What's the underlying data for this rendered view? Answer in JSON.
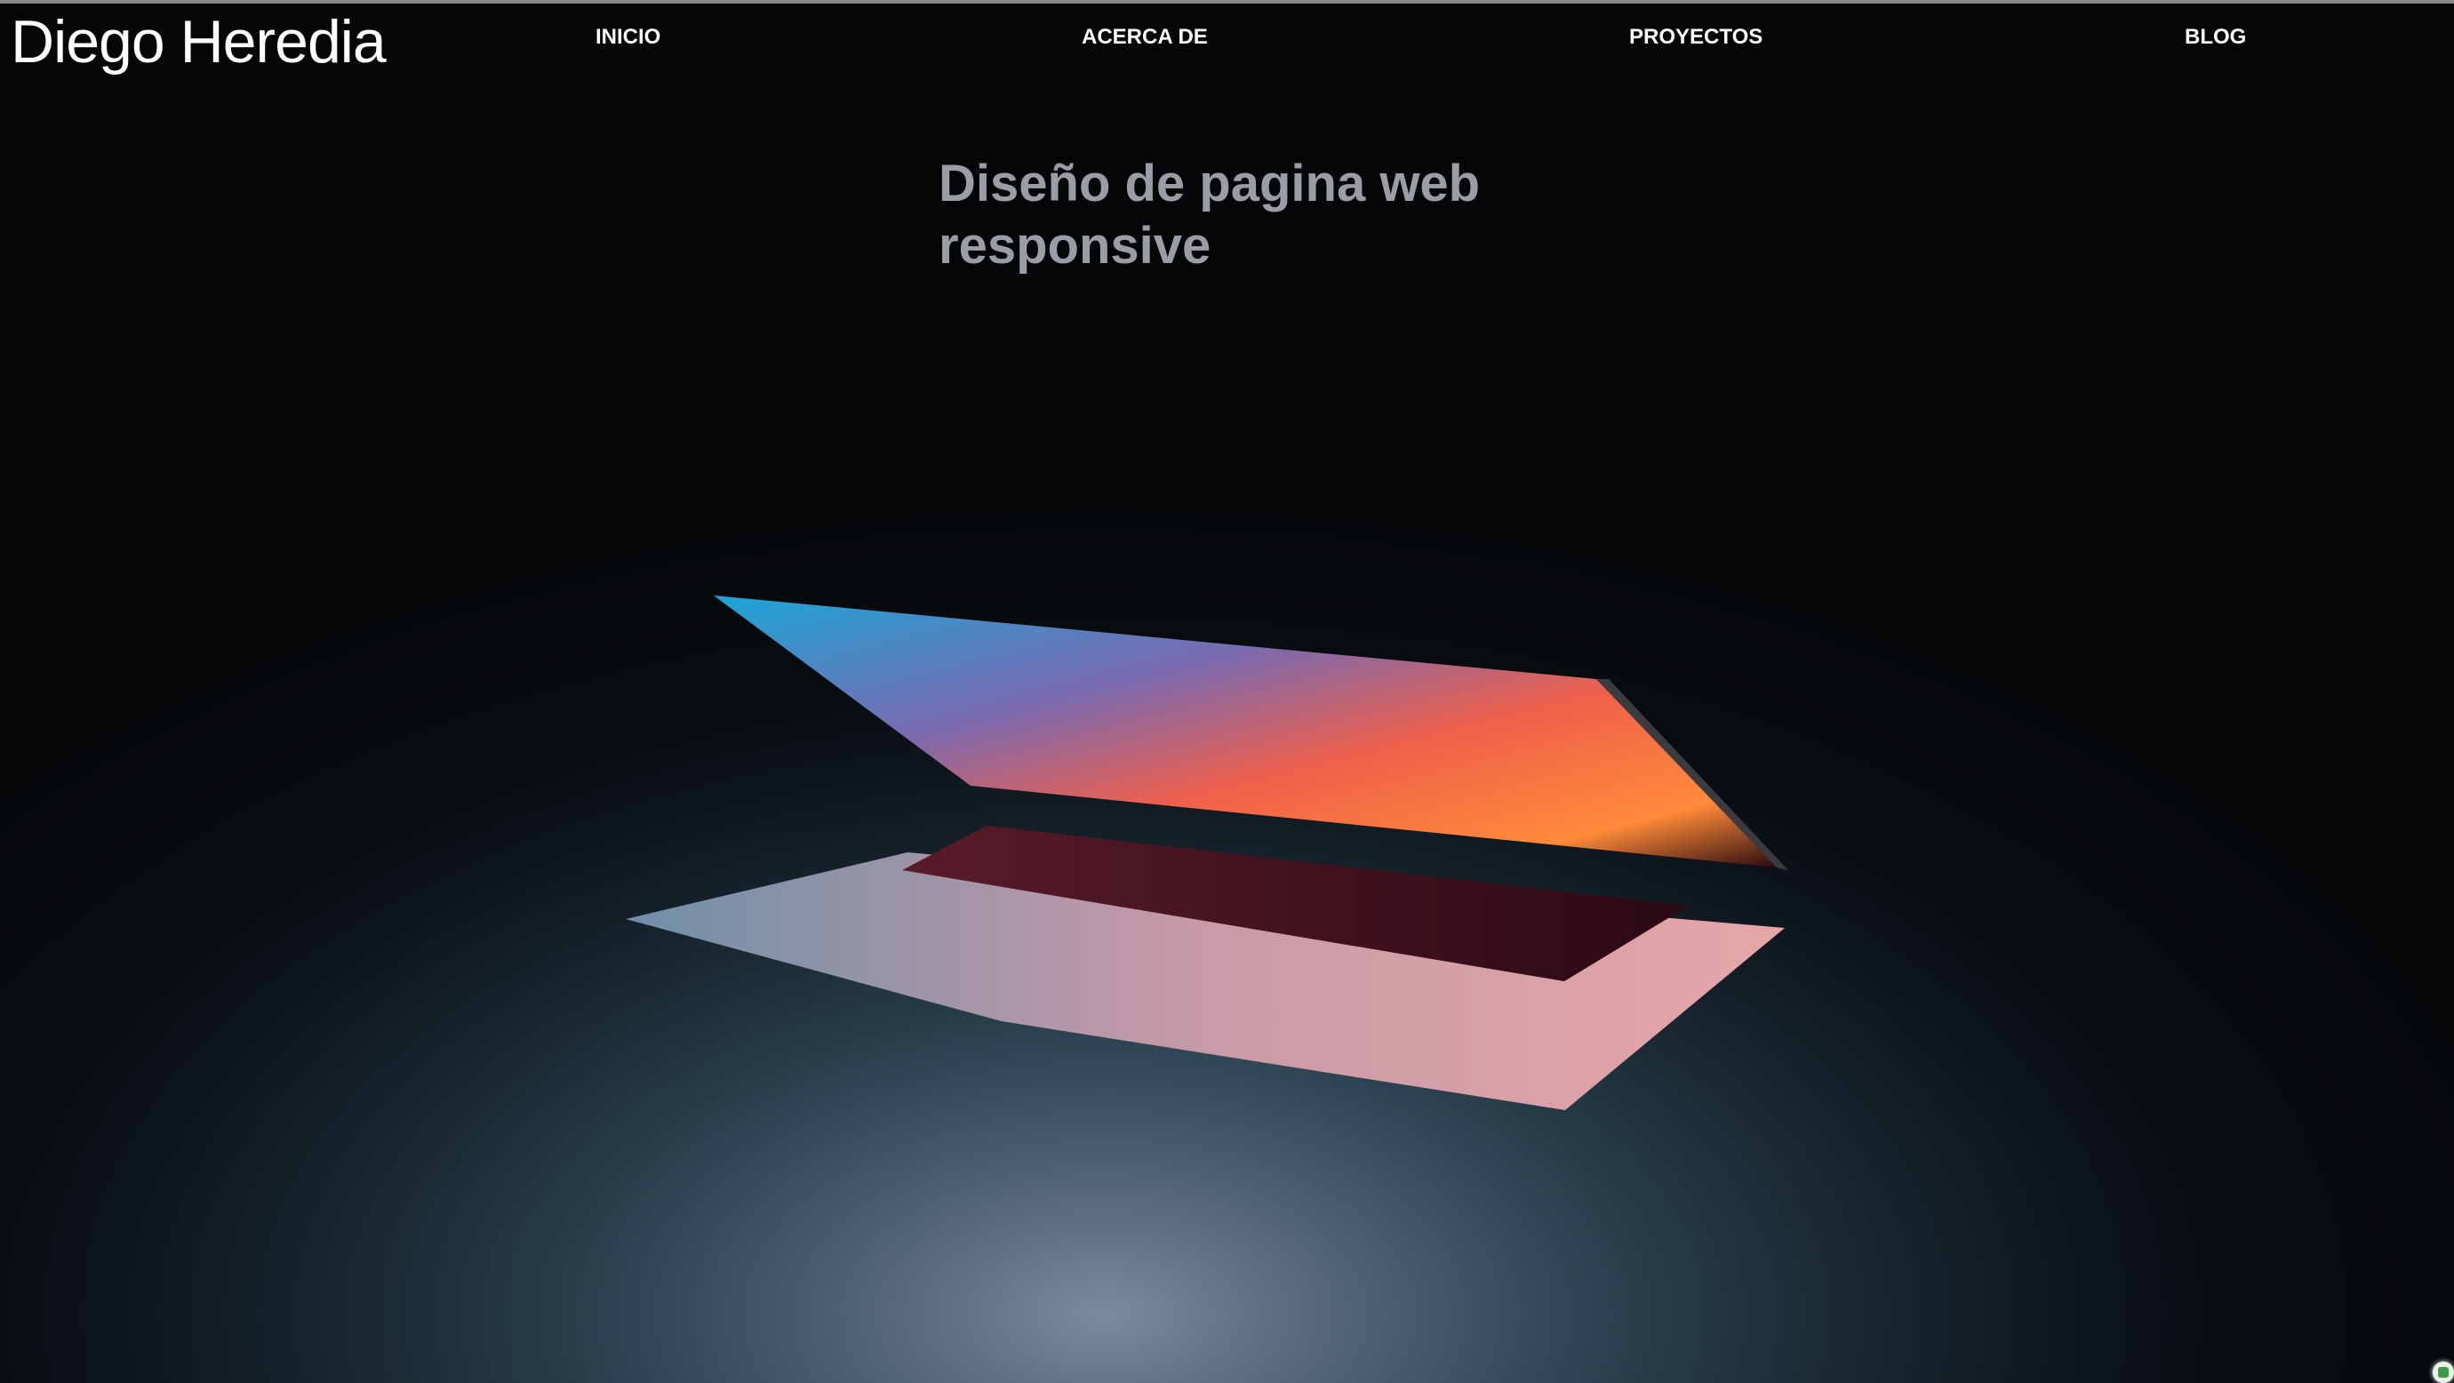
{
  "header": {
    "brand": "Diego Heredia",
    "nav": [
      {
        "label": "INICIO"
      },
      {
        "label": "ACERCA DE"
      },
      {
        "label": "PROYECTOS"
      },
      {
        "label": "BLOG"
      }
    ]
  },
  "hero": {
    "title": "Diseño de pagina web responsive",
    "image": "laptop-half-open-glowing-screen"
  },
  "colors": {
    "background": "#050607",
    "title": "#9b9da6",
    "nav": "#ffffff"
  }
}
